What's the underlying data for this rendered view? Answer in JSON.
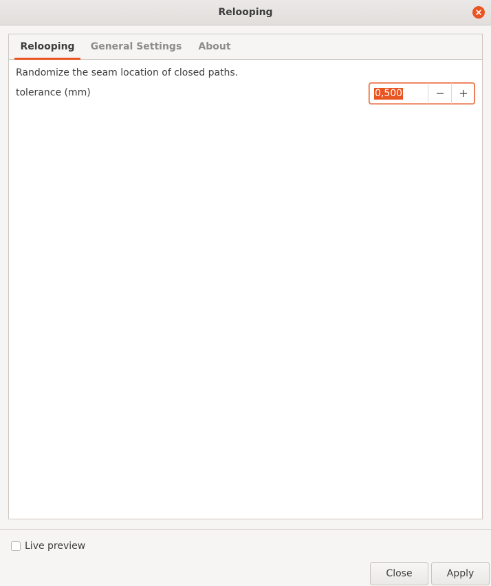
{
  "window": {
    "title": "Relooping"
  },
  "tabs": [
    {
      "label": "Relooping",
      "active": true
    },
    {
      "label": "General Settings",
      "active": false
    },
    {
      "label": "About",
      "active": false
    }
  ],
  "relooping": {
    "description": "Randomize the seam location of closed paths.",
    "tolerance_label": "tolerance (mm)",
    "tolerance_value": "0,500"
  },
  "footer": {
    "live_preview_label": "Live preview",
    "live_preview_checked": false,
    "close_label": "Close",
    "apply_label": "Apply"
  },
  "colors": {
    "accent": "#e95420"
  },
  "icons": {
    "close": "close-icon",
    "minus": "minus-icon",
    "plus": "plus-icon"
  }
}
